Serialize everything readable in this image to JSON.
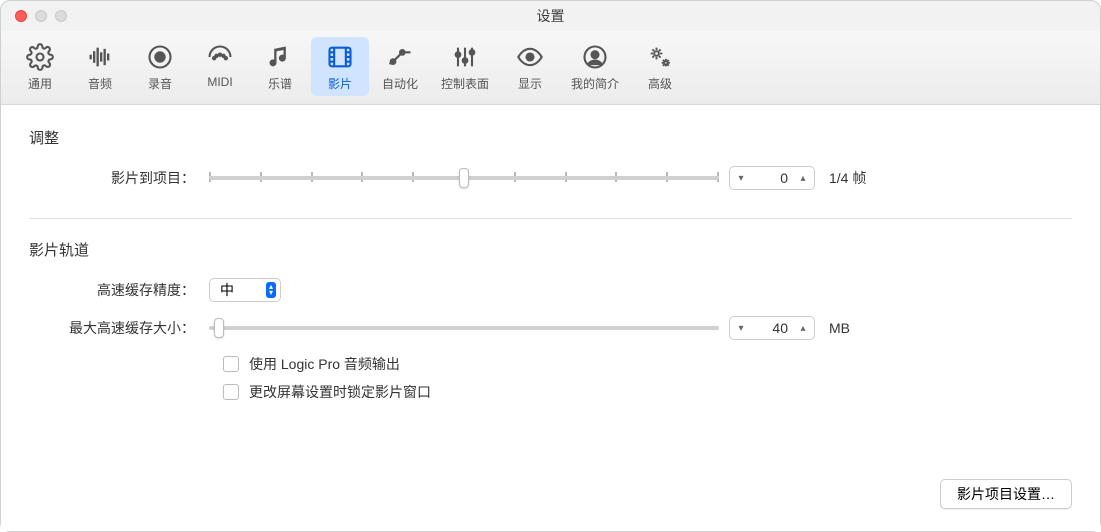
{
  "window": {
    "title": "设置"
  },
  "toolbar": {
    "items": [
      {
        "label": "通用"
      },
      {
        "label": "音频"
      },
      {
        "label": "录音"
      },
      {
        "label": "MIDI"
      },
      {
        "label": "乐谱"
      },
      {
        "label": "影片"
      },
      {
        "label": "自动化"
      },
      {
        "label": "控制表面"
      },
      {
        "label": "显示"
      },
      {
        "label": "我的简介"
      },
      {
        "label": "高级"
      }
    ],
    "active_index": 5
  },
  "sections": {
    "adjust": {
      "title": "调整",
      "movie_to_project": {
        "label": "影片到项目：",
        "value": "0",
        "unit": "1/4 帧",
        "slider_percent": 50
      }
    },
    "track": {
      "title": "影片轨道",
      "cache_precision": {
        "label": "高速缓存精度：",
        "value": "中"
      },
      "max_cache": {
        "label": "最大高速缓存大小：",
        "value": "40",
        "unit": "MB",
        "slider_percent": 2
      },
      "use_logic_audio": {
        "label": "使用 Logic Pro 音频输出",
        "checked": false
      },
      "lock_window": {
        "label": "更改屏幕设置时锁定影片窗口",
        "checked": false
      }
    }
  },
  "footer": {
    "project_settings_button": "影片项目设置…"
  }
}
